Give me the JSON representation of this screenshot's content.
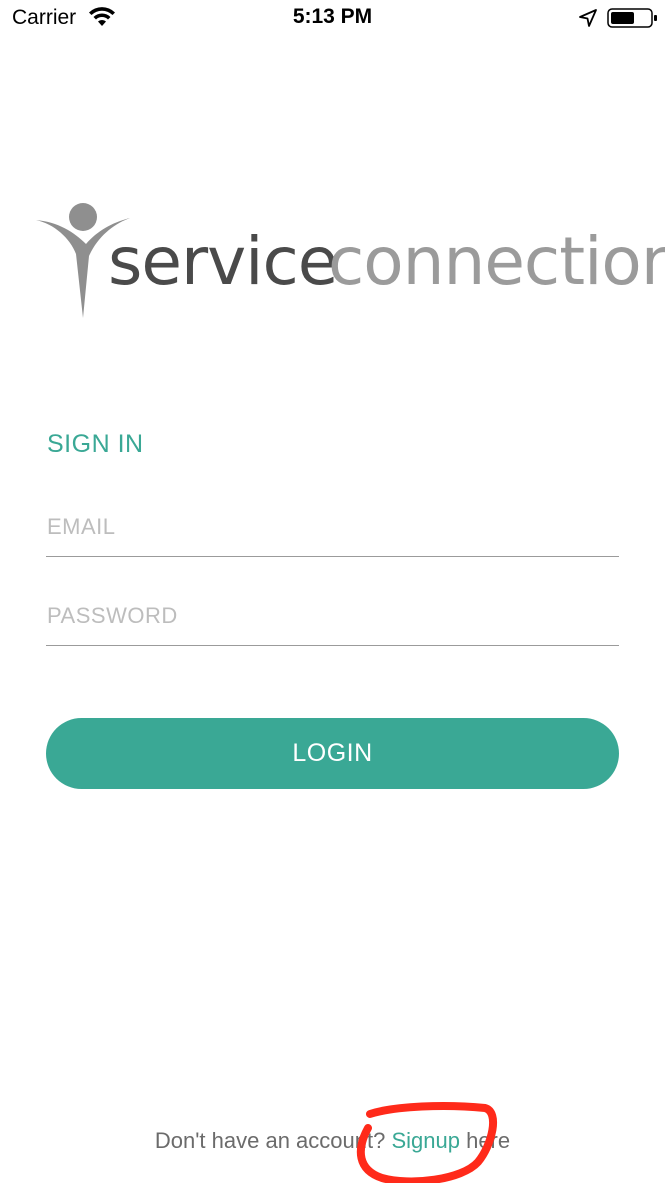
{
  "status_bar": {
    "carrier": "Carrier",
    "time": "5:13 PM",
    "icons": [
      "wifi-icon",
      "location-arrow-icon",
      "battery-icon"
    ]
  },
  "logo": {
    "word_primary": "service",
    "word_secondary": "connection",
    "colors": {
      "primary": "#4a4a4a",
      "secondary": "#9b9b9b"
    }
  },
  "signin": {
    "title": "SIGN IN",
    "email": {
      "value": "",
      "placeholder": "EMAIL"
    },
    "password": {
      "value": "",
      "placeholder": "PASSWORD"
    },
    "login_label": "LOGIN"
  },
  "footer": {
    "prefix": "Don't have an account? ",
    "link": "Signup",
    "suffix": " here"
  },
  "colors": {
    "accent": "#3aa895",
    "annotation": "#ff2a1a"
  }
}
